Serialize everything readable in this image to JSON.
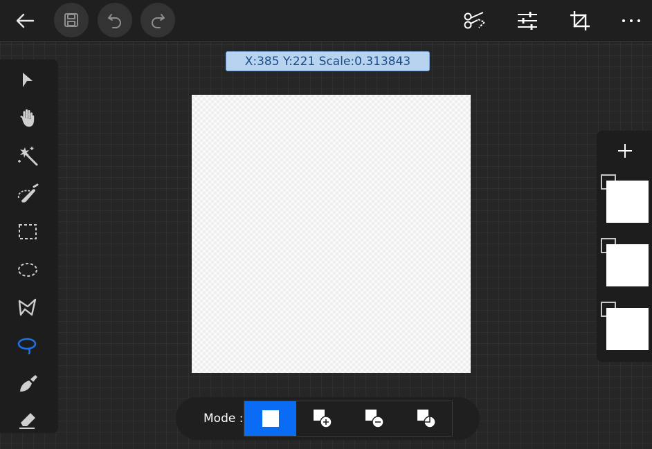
{
  "header": {
    "icons": [
      "back-arrow-icon",
      "save-icon",
      "undo-icon",
      "redo-icon",
      "scissors-icon",
      "adjustments-icon",
      "crop-icon",
      "more-icon"
    ]
  },
  "status": {
    "coords_text": "X:385 Y:221 Scale:0.313843"
  },
  "tools": [
    {
      "name": "select-tool",
      "icon": "arrow-cursor-icon",
      "active": false
    },
    {
      "name": "pan-tool",
      "icon": "hand-icon",
      "active": false
    },
    {
      "name": "magic-wand-tool",
      "icon": "magic-wand-icon",
      "active": false
    },
    {
      "name": "selection-brush-tool",
      "icon": "selection-brush-icon",
      "active": false
    },
    {
      "name": "rectangle-select-tool",
      "icon": "rect-marquee-icon",
      "active": false
    },
    {
      "name": "ellipse-select-tool",
      "icon": "ellipse-marquee-icon",
      "active": false
    },
    {
      "name": "polygon-lasso-tool",
      "icon": "polygon-lasso-icon",
      "active": false
    },
    {
      "name": "lasso-tool",
      "icon": "lasso-icon",
      "active": true
    },
    {
      "name": "brush-tool",
      "icon": "brush-icon",
      "active": false
    },
    {
      "name": "eraser-tool",
      "icon": "eraser-icon",
      "active": false
    }
  ],
  "layers": {
    "add_icon": "plus-icon",
    "count": 3
  },
  "mode": {
    "label": "Mode :",
    "options": [
      "new-selection",
      "add-selection",
      "subtract-selection",
      "intersect-selection"
    ],
    "active": "new-selection"
  },
  "colors": {
    "accent": "#0a6cf5",
    "coords_bg": "#b7d3ef",
    "coords_text": "#1c4c84",
    "panel_bg": "#1d1d1d",
    "icon": "#cfcfcf"
  }
}
